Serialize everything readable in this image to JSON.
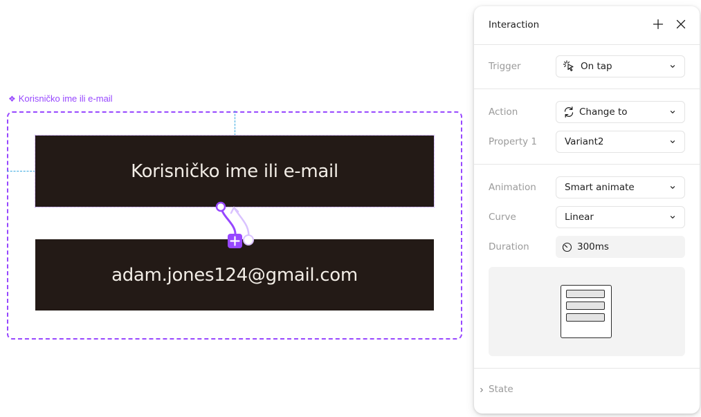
{
  "canvas": {
    "component_label": "Korisničko ime ili e-mail",
    "variant_1_text": "Korisničko ime ili e-mail",
    "variant_2_text": "adam.jones124@gmail.com",
    "colors": {
      "component_accent": "#9747ff",
      "guide": "#35a7e0",
      "variant_fill": "#231a16",
      "variant_text": "#f2ede6"
    }
  },
  "panel": {
    "title": "Interaction",
    "header_icons": [
      "plus-icon",
      "close-icon"
    ],
    "trigger": {
      "label": "Trigger",
      "value": "On tap",
      "icon": "tap-cursor-icon"
    },
    "action": {
      "label": "Action",
      "value": "Change to",
      "icon": "change-to-icon"
    },
    "property": {
      "label": "Property 1",
      "value": "Variant2"
    },
    "animation": {
      "label": "Animation",
      "value": "Smart animate"
    },
    "curve": {
      "label": "Curve",
      "value": "Linear"
    },
    "duration": {
      "label": "Duration",
      "value": "300ms",
      "icon": "timer-icon"
    },
    "preview_icon": "animation-preview-icon",
    "state": {
      "label": "State"
    }
  }
}
